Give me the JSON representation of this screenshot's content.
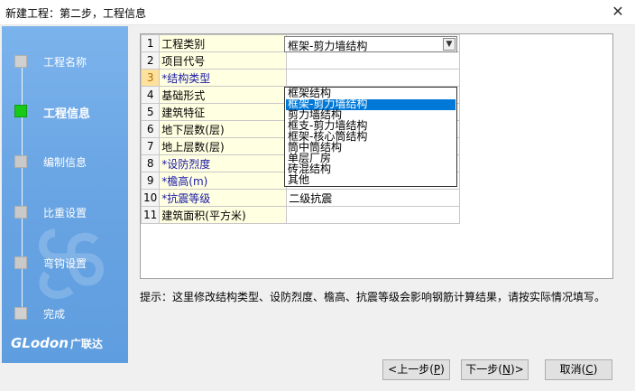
{
  "window": {
    "title": "新建工程：第二步，工程信息"
  },
  "sidebar": {
    "steps": [
      {
        "label": "工程名称"
      },
      {
        "label": "工程信息"
      },
      {
        "label": "编制信息"
      },
      {
        "label": "比重设置"
      },
      {
        "label": "弯钩设置"
      },
      {
        "label": "完成"
      }
    ],
    "logo": {
      "text": "GLodon",
      "cn": "广联达"
    }
  },
  "grid": {
    "rows": [
      {
        "num": "1",
        "name": "工程类别",
        "value": ""
      },
      {
        "num": "2",
        "name": "项目代号",
        "value": ""
      },
      {
        "num": "3",
        "name": "*结构类型",
        "value": "框架-剪力墙结构"
      },
      {
        "num": "4",
        "name": "基础形式",
        "value": ""
      },
      {
        "num": "5",
        "name": "建筑特征",
        "value": ""
      },
      {
        "num": "6",
        "name": "地下层数(层)",
        "value": ""
      },
      {
        "num": "7",
        "name": "地上层数(层)",
        "value": ""
      },
      {
        "num": "8",
        "name": "*设防烈度",
        "value": ""
      },
      {
        "num": "9",
        "name": "*檐高(m)",
        "value": ""
      },
      {
        "num": "10",
        "name": "*抗震等级",
        "value": "二级抗震"
      },
      {
        "num": "11",
        "name": "建筑面积(平方米)",
        "value": ""
      }
    ]
  },
  "dropdown": {
    "current": "框架-剪力墙结构",
    "options": [
      "框架结构",
      "框架-剪力墙结构",
      "剪力墙结构",
      "框支-剪力墙结构",
      "框架-核心筒结构",
      "筒中筒结构",
      "单层厂房",
      "砖混结构",
      "其他"
    ],
    "selected_index": 1
  },
  "hint": "提示：这里修改结构类型、设防烈度、檐高、抗震等级会影响钢筋计算结果，请按实际情况填写。",
  "buttons": {
    "prev": {
      "label": "<上一步(",
      "key": "P",
      "end": ")"
    },
    "next": {
      "label": "下一步(",
      "key": "N",
      "end": ")>"
    },
    "cancel": {
      "label": "取消(",
      "key": "C",
      "end": ")"
    }
  },
  "colors": {
    "active_step": "#19c919",
    "selection": "#0078d7",
    "sidebar": "#6aa5e4",
    "name_cell": "#ffffe1",
    "required_text": "#1a1aa6"
  }
}
